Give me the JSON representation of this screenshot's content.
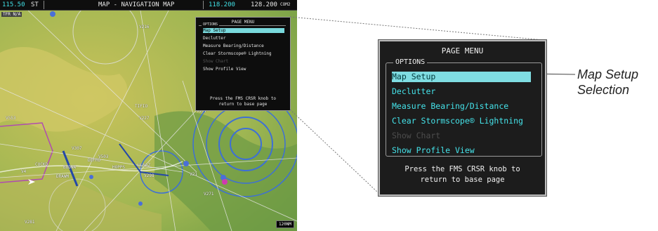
{
  "screen": {
    "header": {
      "left_value": "115.50",
      "left_suffix": "ST",
      "title": "MAP - NAVIGATION MAP",
      "freq_active": "118.200",
      "freq_standby": "128.200",
      "freq_label": "COM2"
    },
    "map": {
      "terrain_label": "TFR N/A",
      "scale": "120NM",
      "labels": [
        "V216",
        "V307",
        "V553",
        "V21",
        "V271",
        "V277",
        "V298",
        "V4",
        "V281",
        "HOPPS",
        "ULNAZ",
        "DRAWM",
        "CUCKD",
        "BUDWA",
        "DEFRO",
        "V503",
        "TIFIO",
        "V227"
      ]
    }
  },
  "small_menu": {
    "title": "PAGE MENU",
    "group_label": "OPTIONS",
    "items": [
      "Map Setup",
      "Declutter",
      "Measure Bearing/Distance",
      "Clear Stormscope® Lightning",
      "Show Chart",
      "Show Profile View"
    ],
    "hint": [
      "Press the FMS CRSR knob to",
      "return to base page"
    ]
  },
  "page_menu": {
    "title": "PAGE MENU",
    "group_label": "OPTIONS",
    "items": [
      {
        "label": "Map Setup",
        "state": "selected"
      },
      {
        "label": "Declutter",
        "state": "normal"
      },
      {
        "label": "Measure Bearing/Distance",
        "state": "normal"
      },
      {
        "label": "Clear Stormscope® Lightning",
        "state": "normal"
      },
      {
        "label": "Show Chart",
        "state": "disabled"
      },
      {
        "label": "Show Profile View",
        "state": "normal"
      }
    ],
    "hint_line1": "Press the FMS CRSR knob to",
    "hint_line2": "return to base page"
  },
  "callout": {
    "line1": "Map Setup",
    "line2": "Selection"
  },
  "colors": {
    "menu_cyan": "#45e3ea",
    "selection_bg": "#7fdde2",
    "terrain_yellow": "#c8c35a",
    "terrain_green": "#7fae4a",
    "airspace_blue": "#3d6fd6"
  }
}
